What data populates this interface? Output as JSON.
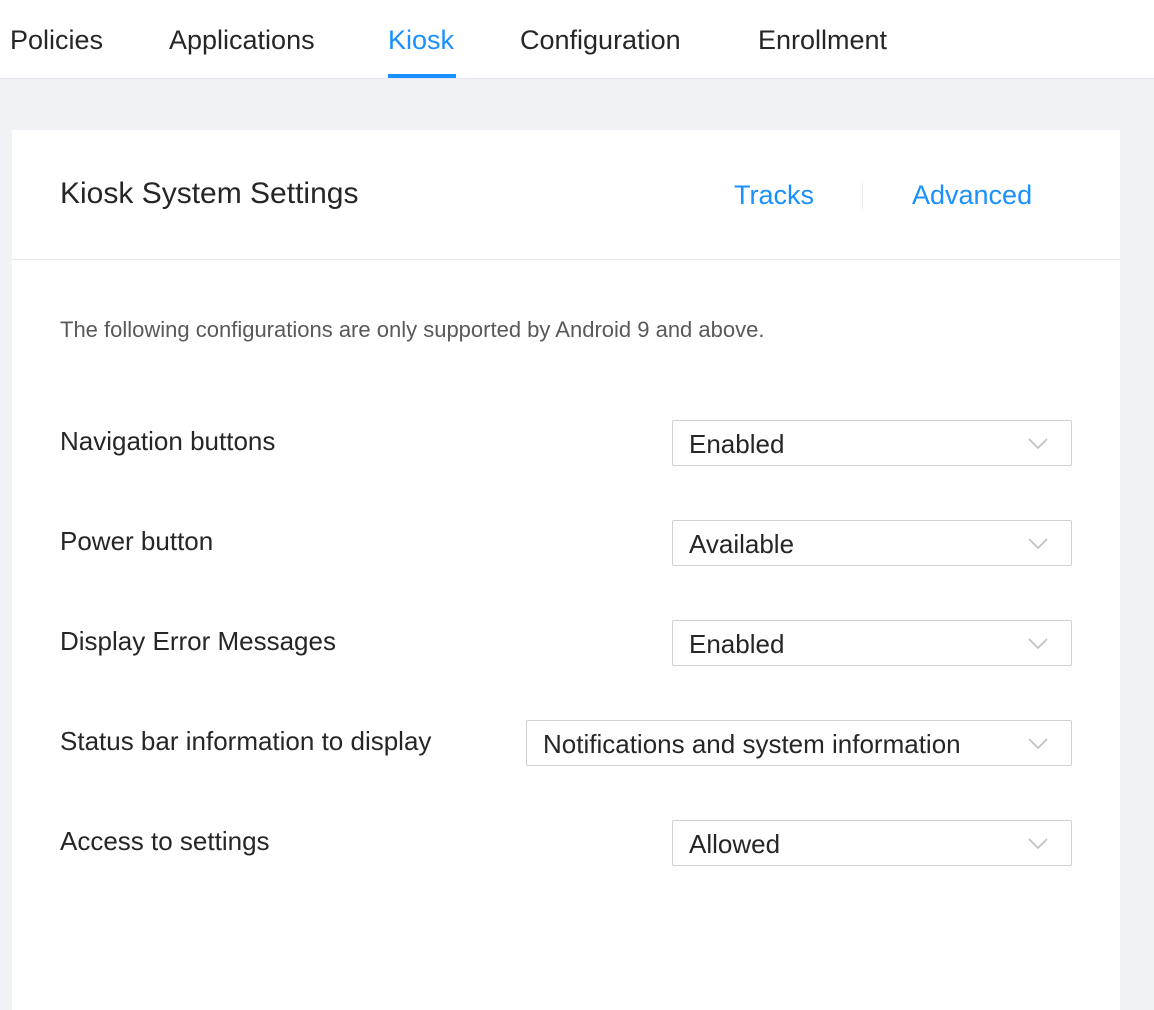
{
  "nav": {
    "tabs": [
      {
        "label": "Policies"
      },
      {
        "label": "Applications"
      },
      {
        "label": "Kiosk"
      },
      {
        "label": "Configuration"
      },
      {
        "label": "Enrollment"
      }
    ],
    "active_tab": "Kiosk"
  },
  "card": {
    "title": "Kiosk System Settings",
    "links": {
      "tracks": "Tracks",
      "advanced": "Advanced"
    },
    "info": "The following configurations are only supported by Android 9 and above.",
    "settings": [
      {
        "label": "Navigation buttons",
        "value": "Enabled"
      },
      {
        "label": "Power button",
        "value": "Available"
      },
      {
        "label": "Display Error Messages",
        "value": "Enabled"
      },
      {
        "label": "Status bar information to display",
        "value": "Notifications and system information"
      },
      {
        "label": "Access to settings",
        "value": "Allowed"
      }
    ]
  },
  "icons": {
    "dropdown": "chevron-down-icon"
  },
  "colors": {
    "accent": "#1890ff",
    "background": "#f0f2f5",
    "text": "#262626",
    "muted_text": "#595959",
    "border": "#d0d0d0"
  }
}
